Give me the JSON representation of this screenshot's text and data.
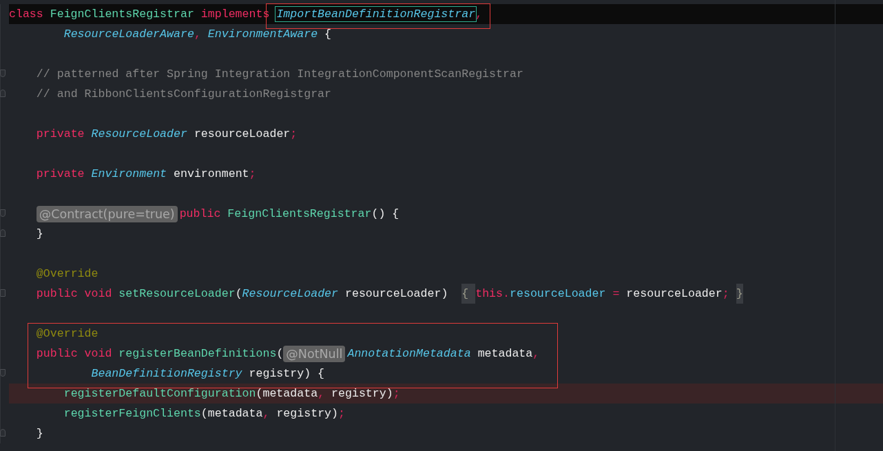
{
  "editor": {
    "lines": [
      {
        "kind": "current",
        "tokens": [
          {
            "kind": "keyword",
            "text": "class "
          },
          {
            "kind": "class",
            "text": "FeignClientsRegistrar "
          },
          {
            "kind": "keyword",
            "text": "implements "
          },
          {
            "kind": "type",
            "text": "ImportBeanDefinitionRegistrar",
            "boxed": true
          },
          {
            "kind": "punct",
            "text": ","
          }
        ]
      },
      {
        "kind": "plain",
        "tokens": [
          {
            "kind": "type",
            "text": "        ResourceLoaderAware"
          },
          {
            "kind": "punct",
            "text": ", "
          },
          {
            "kind": "type",
            "text": "EnvironmentAware "
          },
          {
            "kind": "plain",
            "text": "{"
          }
        ]
      },
      {
        "kind": "plain"
      },
      {
        "kind": "plain",
        "gutter_mark": {
          "kind": "fold-start"
        },
        "tokens": [
          {
            "kind": "comment",
            "text": "    // patterned after Spring Integration IntegrationComponentScanRegistrar"
          }
        ]
      },
      {
        "kind": "plain",
        "gutter_mark": {
          "kind": "fold-end"
        },
        "tokens": [
          {
            "kind": "comment",
            "text": "    // and RibbonClientsConfigurationRegistgrar"
          }
        ]
      },
      {
        "kind": "plain"
      },
      {
        "kind": "plain",
        "tokens": [
          {
            "kind": "keyword",
            "text": "    private "
          },
          {
            "kind": "type",
            "text": "ResourceLoader "
          },
          {
            "kind": "plain",
            "text": "resourceLoader"
          },
          {
            "kind": "punct",
            "text": ";"
          }
        ]
      },
      {
        "kind": "plain"
      },
      {
        "kind": "plain",
        "tokens": [
          {
            "kind": "keyword",
            "text": "    private "
          },
          {
            "kind": "type",
            "text": "Environment "
          },
          {
            "kind": "plain",
            "text": "environment"
          },
          {
            "kind": "punct",
            "text": ";"
          }
        ]
      },
      {
        "kind": "plain"
      },
      {
        "kind": "plain",
        "gutter_mark": {
          "kind": "fold-start"
        },
        "tokens": [
          {
            "kind": "inlay",
            "text": "    @Contract(pure=true)"
          },
          {
            "kind": "keyword",
            "text": "public "
          },
          {
            "kind": "method",
            "text": "FeignClientsRegistrar"
          },
          {
            "kind": "plain",
            "text": "() {"
          }
        ]
      },
      {
        "kind": "plain",
        "gutter_mark": {
          "kind": "fold-end"
        },
        "tokens": [
          {
            "kind": "plain",
            "text": "    }"
          }
        ]
      },
      {
        "kind": "plain"
      },
      {
        "kind": "plain",
        "tokens": [
          {
            "kind": "annotation",
            "text": "    @Override"
          }
        ]
      },
      {
        "kind": "plain",
        "gutter_mark": {
          "kind": "collapsed"
        },
        "tokens": [
          {
            "kind": "keyword",
            "text": "    public void "
          },
          {
            "kind": "method",
            "text": "setResourceLoader"
          },
          {
            "kind": "plain",
            "text": "("
          },
          {
            "kind": "type",
            "text": "ResourceLoader "
          },
          {
            "kind": "plain",
            "text": "resourceLoader) "
          },
          {
            "kind": "folded",
            "text": " { "
          },
          {
            "kind": "keyword",
            "text": "this"
          },
          {
            "kind": "punct",
            "text": "."
          },
          {
            "kind": "field",
            "text": "resourceLoader "
          },
          {
            "kind": "punct",
            "text": "= "
          },
          {
            "kind": "plain",
            "text": "resourceLoader"
          },
          {
            "kind": "punct",
            "text": ";"
          },
          {
            "kind": "folded",
            "text": " }"
          }
        ]
      },
      {
        "kind": "plain"
      },
      {
        "kind": "plain",
        "tokens": [
          {
            "kind": "annotation",
            "text": "    @Override"
          }
        ]
      },
      {
        "kind": "plain",
        "tokens": [
          {
            "kind": "keyword",
            "text": "    public void "
          },
          {
            "kind": "method",
            "text": "registerBeanDefinitions"
          },
          {
            "kind": "plain",
            "text": "("
          },
          {
            "kind": "inlay",
            "text": "@NotNull"
          },
          {
            "kind": "type",
            "text": "AnnotationMetadata "
          },
          {
            "kind": "plain",
            "text": "metadata"
          },
          {
            "kind": "punct",
            "text": ","
          }
        ]
      },
      {
        "kind": "plain",
        "gutter_mark": {
          "kind": "fold-start"
        },
        "tokens": [
          {
            "kind": "type",
            "text": "            BeanDefinitionRegistry "
          },
          {
            "kind": "plain",
            "text": "registry) {"
          }
        ]
      },
      {
        "kind": "breakpoint",
        "tokens": [
          {
            "kind": "method",
            "text": "        registerDefaultConfiguration"
          },
          {
            "kind": "plain",
            "text": "(metadata"
          },
          {
            "kind": "punct",
            "text": ", "
          },
          {
            "kind": "plain",
            "text": "registry)"
          },
          {
            "kind": "punct",
            "text": ";"
          }
        ]
      },
      {
        "kind": "plain",
        "tokens": [
          {
            "kind": "method",
            "text": "        registerFeignClients"
          },
          {
            "kind": "plain",
            "text": "(metadata"
          },
          {
            "kind": "punct",
            "text": ", "
          },
          {
            "kind": "plain",
            "text": "registry)"
          },
          {
            "kind": "punct",
            "text": ";"
          }
        ]
      },
      {
        "kind": "plain",
        "gutter_mark": {
          "kind": "fold-end"
        },
        "tokens": [
          {
            "kind": "plain",
            "text": "    }"
          }
        ]
      }
    ]
  }
}
